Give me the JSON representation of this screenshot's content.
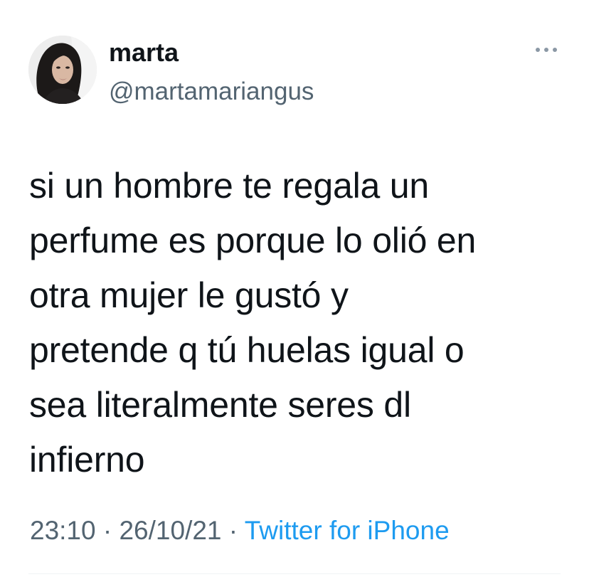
{
  "user": {
    "display_name": "marta",
    "handle": "@martamariangus",
    "avatar_icon": "profile-photo"
  },
  "more_menu_icon": "ellipsis-icon",
  "tweet": {
    "text": "si un hombre te regala un\nperfume es porque lo olió en\notra mujer le gustó y\npretende q tú huelas igual o\nsea literalmente seres dl\ninfierno"
  },
  "meta": {
    "time": "23:10",
    "separator1": " · ",
    "date": "26/10/21",
    "separator2": " · ",
    "source": "Twitter for iPhone"
  },
  "colors": {
    "text": "#0f1419",
    "secondary": "#536471",
    "link": "#1d9bf0",
    "divider": "#eff3f4"
  }
}
